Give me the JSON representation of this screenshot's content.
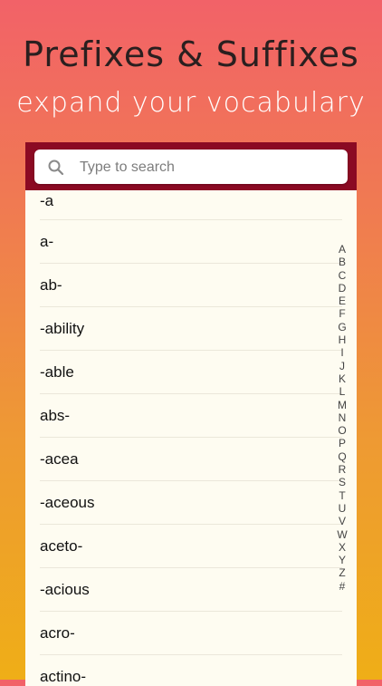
{
  "header": {
    "title": "Prefixes & Suffixes",
    "subtitle": "expand your vocabulary"
  },
  "search": {
    "placeholder": "Type to search",
    "icon": "search-icon"
  },
  "list": {
    "items": [
      "-a",
      "a-",
      "ab-",
      "-ability",
      "-able",
      "abs-",
      "-acea",
      "-aceous",
      "aceto-",
      "-acious",
      "acro-",
      "actino-"
    ]
  },
  "index": {
    "letters": [
      "A",
      "B",
      "C",
      "D",
      "E",
      "F",
      "G",
      "H",
      "I",
      "J",
      "K",
      "L",
      "M",
      "N",
      "O",
      "P",
      "Q",
      "R",
      "S",
      "T",
      "U",
      "V",
      "W",
      "X",
      "Y",
      "Z",
      "#"
    ]
  }
}
